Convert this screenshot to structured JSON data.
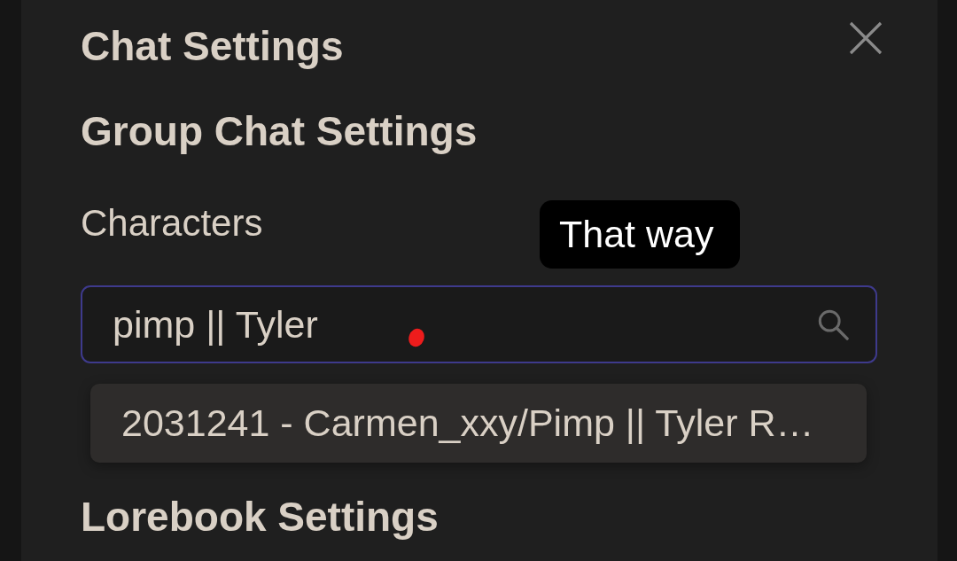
{
  "dialog": {
    "title": "Chat Settings"
  },
  "group_chat": {
    "heading": "Group Chat Settings",
    "field_label": "Characters",
    "tooltip": "That way",
    "search": {
      "value": "pimp || Tyler"
    },
    "suggestions": [
      {
        "label": "2031241 - Carmen_xxy/Pimp || Tyler R…"
      }
    ]
  },
  "lorebook": {
    "heading": "Lorebook Settings"
  }
}
